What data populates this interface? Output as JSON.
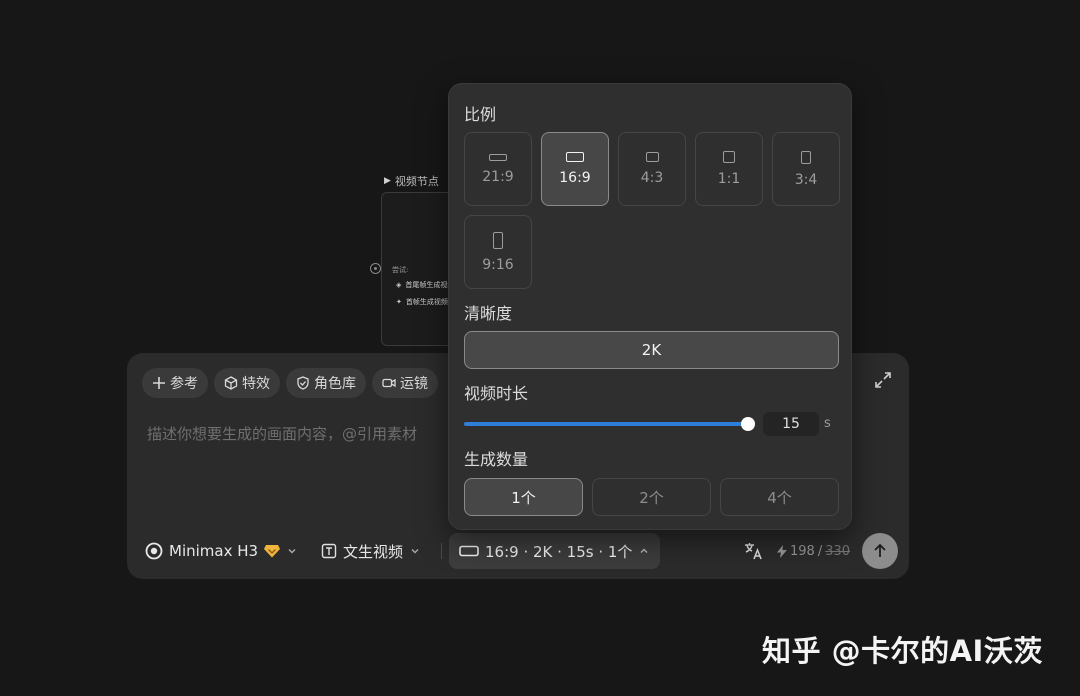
{
  "node": {
    "title": "视频节点",
    "hint": "尝试:",
    "options": [
      "首尾帧生成视频",
      "首帧生成视频"
    ]
  },
  "panel": {
    "chips": [
      "参考",
      "特效",
      "角色库",
      "运镜"
    ],
    "prompt_placeholder": "描述你想要生成的画面内容，@引用素材",
    "model": "Minimax H3",
    "mode": "文生视频",
    "params_summary": "16:9 · 2K · 15s · 1个",
    "credits": "198",
    "credits_original": "330"
  },
  "popover": {
    "ratio_label": "比例",
    "ratios": [
      {
        "label": "21:9",
        "active": false
      },
      {
        "label": "16:9",
        "active": true
      },
      {
        "label": "4:3",
        "active": false
      },
      {
        "label": "1:1",
        "active": false
      },
      {
        "label": "3:4",
        "active": false
      },
      {
        "label": "9:16",
        "active": false
      }
    ],
    "resolution_label": "清晰度",
    "resolution_value": "2K",
    "duration_label": "视频时长",
    "duration_value": "15",
    "duration_unit": "s",
    "duration_fraction": 1.0,
    "count_label": "生成数量",
    "counts": [
      {
        "label": "1个",
        "active": true
      },
      {
        "label": "2个",
        "active": false
      },
      {
        "label": "4个",
        "active": false
      }
    ]
  },
  "watermark": "知乎 @卡尔的AI沃茨",
  "colors": {
    "accent": "#2f7fd8",
    "badge": "#f0b43c"
  }
}
